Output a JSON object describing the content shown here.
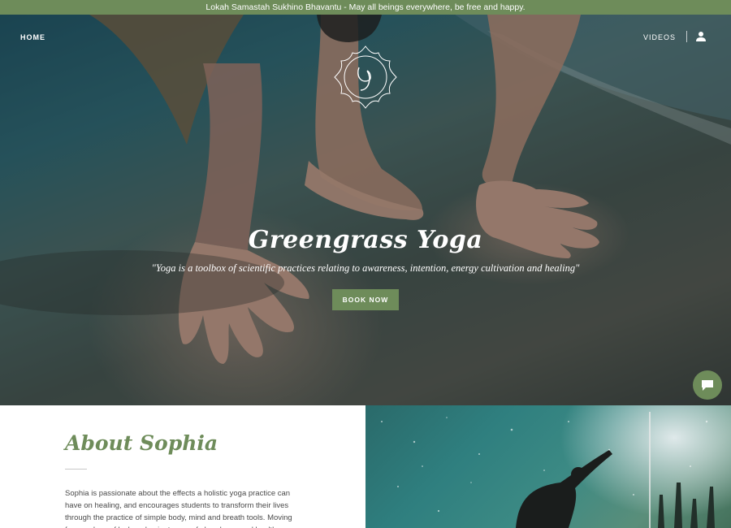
{
  "announcement": "Lokah Samastah Sukhino Bhavantu - May all beings everywhere, be free and happy.",
  "nav": {
    "home_label": "HOME",
    "videos_label": "VIDEOS",
    "user_icon": "user-icon"
  },
  "hero": {
    "logo_icon": "greengrass-logo",
    "title": "Greengrass Yoga",
    "quote": "\"Yoga is a toolbox of scientific practices relating to awareness, intention, energy cultivation and healing\"",
    "button_label": "BOOK NOW"
  },
  "chat": {
    "icon": "chat-icon"
  },
  "about": {
    "title": "About Sophia",
    "text": "Sophia is passionate about the effects a holistic yoga practice can have on healing, and encourages students to transform their lives through the practice of simple body, mind and breath tools. Moving from a place of lack and pain, to one of abundance and health."
  },
  "colors": {
    "accent": "#6e8c5a",
    "body_text": "#4a4a4a"
  }
}
